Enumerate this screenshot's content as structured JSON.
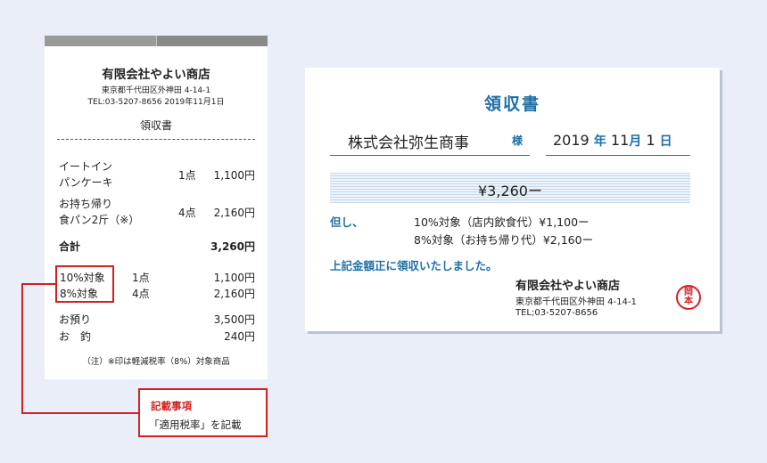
{
  "receipt": {
    "shop_name": "有限会社やよい商店",
    "address": "東京都千代田区外神田 4-14-1",
    "tel_date": "TEL:03-5207-8656 2019年11月1日",
    "title": "領収書",
    "items": [
      {
        "name_line1": "イートイン",
        "name_line2": "パンケーキ",
        "qty": "1点",
        "price": "1,100円"
      },
      {
        "name_line1": "お持ち帰り",
        "name_line2": "食パン2斤（※）",
        "qty": "4点",
        "price": "2,160円"
      }
    ],
    "total_label": "合計",
    "total_value": "3,260円",
    "tax_rows": [
      {
        "label": "10%対象",
        "qty": "1点",
        "value": "1,100円"
      },
      {
        "label": "8%対象",
        "qty": "4点",
        "value": "2,160円"
      }
    ],
    "deposit_label": "お預り",
    "deposit_value": "3,500円",
    "change_label": "お　釣",
    "change_value": "240円",
    "note": "（注）※印は軽減税率（8%）対象商品"
  },
  "callout": {
    "title": "記載事項",
    "body": "「適用税率」を記載"
  },
  "invoice": {
    "title": "領収書",
    "recipient": "株式会社弥生商事",
    "honorific": "様",
    "year": "2019",
    "year_unit": "年",
    "month": "11",
    "month_unit": "月",
    "day": "1",
    "day_unit": "日",
    "amount": "¥3,260ー",
    "proviso_label": "但し、",
    "proviso_line1": "10%対象（店内飲食代）¥1,100ー",
    "proviso_line2": "8%対象（お持ち帰り代）¥2,160ー",
    "received_text": "上記金額正に領収いたしました。",
    "shop_name": "有限会社やよい商店",
    "address": "東京都千代田区外神田 4-14-1",
    "tel": "TEL;03-5207-8656",
    "seal_top": "岡",
    "seal_bottom": "本"
  },
  "colors": {
    "accent_blue": "#1e6fa8",
    "highlight_red": "#d42020",
    "background": "#e9eef8"
  }
}
